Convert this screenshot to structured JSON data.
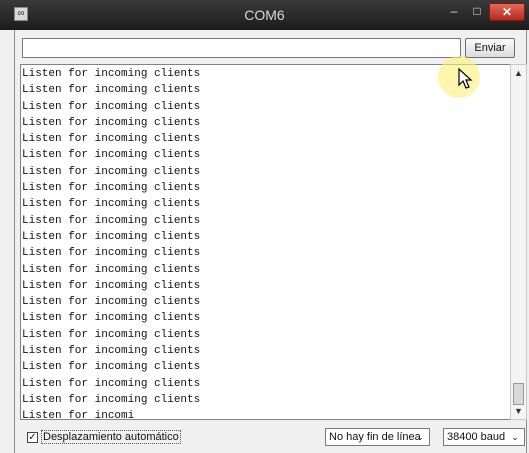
{
  "window": {
    "title": "COM6",
    "app_icon": "arduino-serial-icon",
    "controls": {
      "minimize": "–",
      "maximize": "□",
      "close": "✕"
    }
  },
  "send": {
    "input_value": "",
    "button_label": "Enviar"
  },
  "output": {
    "lines": [
      "Listen for incoming clients",
      "Listen for incoming clients",
      "Listen for incoming clients",
      "Listen for incoming clients",
      "Listen for incoming clients",
      "Listen for incoming clients",
      "Listen for incoming clients",
      "Listen for incoming clients",
      "Listen for incoming clients",
      "Listen for incoming clients",
      "Listen for incoming clients",
      "Listen for incoming clients",
      "Listen for incoming clients",
      "Listen for incoming clients",
      "Listen for incoming clients",
      "Listen for incoming clients",
      "Listen for incoming clients",
      "Listen for incoming clients",
      "Listen for incoming clients",
      "Listen for incoming clients",
      "Listen for incoming clients",
      "Listen for incomi"
    ]
  },
  "scrollbar": {
    "up_icon": "chevron-up-icon",
    "down_icon": "chevron-down-icon"
  },
  "footer": {
    "autoscroll_checked": true,
    "autoscroll_label": "Desplazamiento automático",
    "line_ending": "No hay fin de línea",
    "baud_rate": "38400 baud"
  },
  "colors": {
    "titlebar": "#2a2a2a",
    "close_button": "#c9302c",
    "cursor_highlight": "#fff078"
  }
}
